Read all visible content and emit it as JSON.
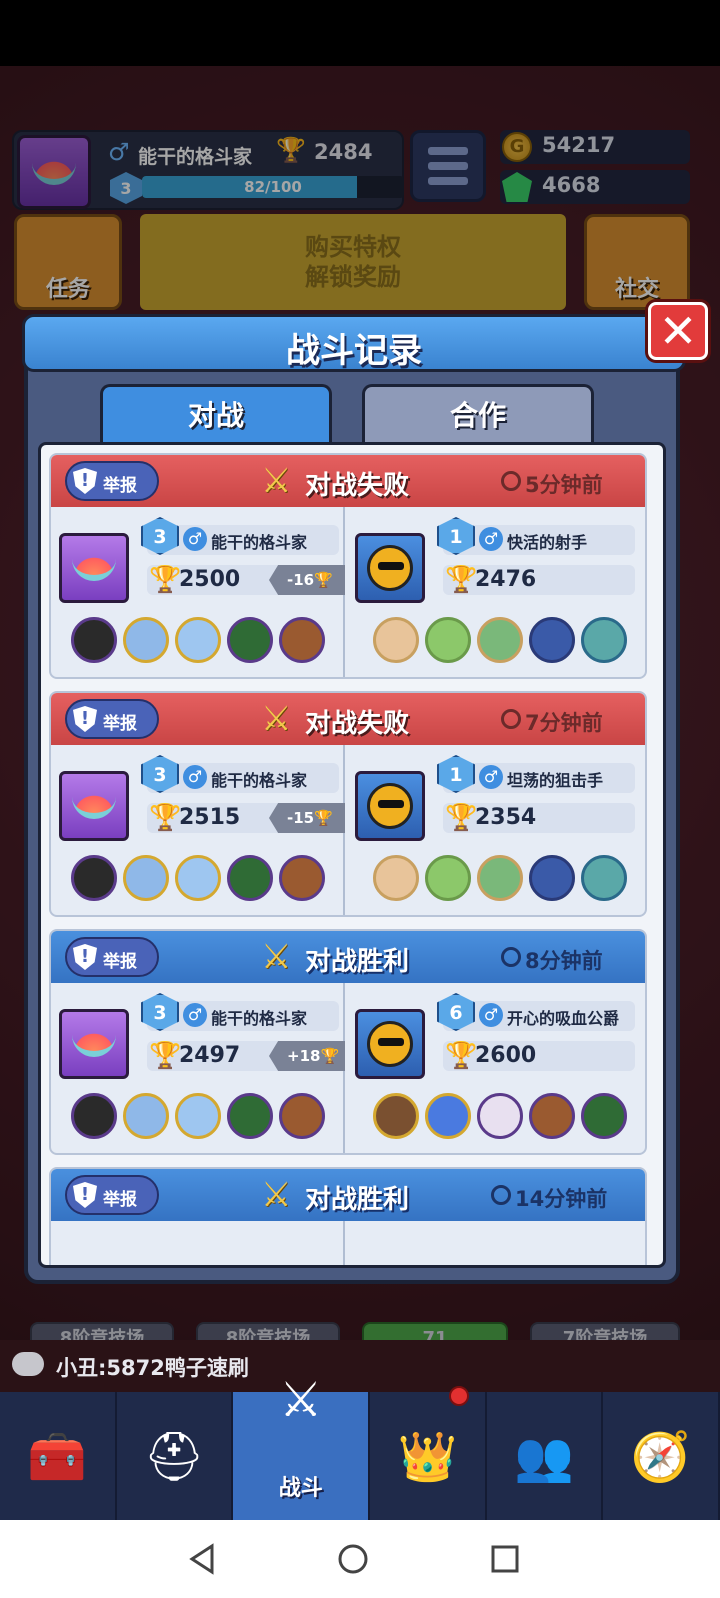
{
  "hud": {
    "player_name": "能干的格斗家",
    "trophies": "2484",
    "level": "3",
    "xp_text": "82/100",
    "xp_fraction": 0.82,
    "coins": "54217",
    "gems": "4668"
  },
  "side_tiles": {
    "tasks": "任务",
    "social": "社交"
  },
  "vip": {
    "line1": "购买特权",
    "line2": "解锁奖励"
  },
  "arena_buttons": [
    "8阶竞技场",
    "8阶竞技场",
    "71",
    "7阶竞技场"
  ],
  "chat": {
    "message": "小丑:5872鸭子速刷"
  },
  "nav": {
    "battle_label": "战斗"
  },
  "modal": {
    "title": "战斗记录",
    "tabs": {
      "battle": "对战",
      "coop": "合作"
    },
    "report_label": "举报",
    "records": [
      {
        "result": "对战失败",
        "time": "5分钟前",
        "left": {
          "level": "3",
          "name": "能干的格斗家",
          "score": "2500",
          "delta": "-16"
        },
        "right": {
          "level": "1",
          "name": "快活的射手",
          "score": "2476"
        }
      },
      {
        "result": "对战失败",
        "time": "7分钟前",
        "left": {
          "level": "3",
          "name": "能干的格斗家",
          "score": "2515",
          "delta": "-15"
        },
        "right": {
          "level": "1",
          "name": "坦荡的狙击手",
          "score": "2354"
        }
      },
      {
        "result": "对战胜利",
        "time": "8分钟前",
        "left": {
          "level": "3",
          "name": "能干的格斗家",
          "score": "2497",
          "delta": "+18"
        },
        "right": {
          "level": "6",
          "name": "开心的吸血公爵",
          "score": "2600"
        }
      },
      {
        "result": "对战胜利",
        "time": "14分钟前"
      }
    ]
  },
  "colors": {
    "lose": "#c94545",
    "win": "#3573c3",
    "accent": "#3f8ee0"
  }
}
